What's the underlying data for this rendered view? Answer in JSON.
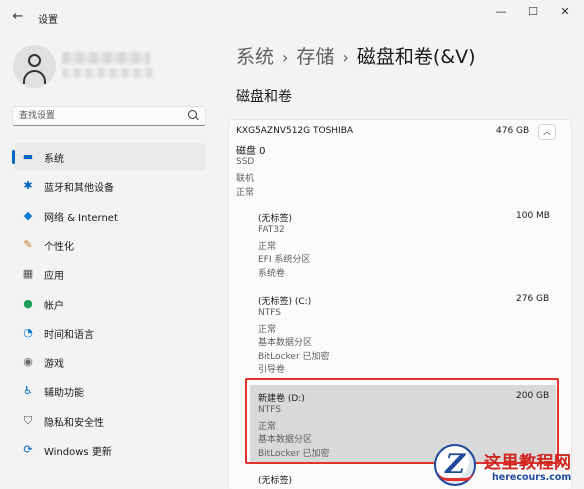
{
  "window": {
    "title": "设置",
    "back_glyph": "←",
    "minimize_glyph": "—",
    "maximize_glyph": "☐",
    "close_glyph": "✕"
  },
  "search": {
    "placeholder": "查找设置"
  },
  "sidebar": {
    "items": [
      {
        "label": "系统",
        "icon": "monitor-icon",
        "glyph": "▬",
        "color": "#0067c0",
        "active": true
      },
      {
        "label": "蓝牙和其他设备",
        "icon": "bluetooth-icon",
        "glyph": "✱",
        "color": "#0067c0",
        "active": false
      },
      {
        "label": "网络 & Internet",
        "icon": "wifi-icon",
        "glyph": "◆",
        "color": "#0078d4",
        "active": false
      },
      {
        "label": "个性化",
        "icon": "brush-icon",
        "glyph": "✎",
        "color": "#c5742a",
        "active": false
      },
      {
        "label": "应用",
        "icon": "apps-icon",
        "glyph": "▦",
        "color": "#555555",
        "active": false
      },
      {
        "label": "帐户",
        "icon": "person-icon",
        "glyph": "●",
        "color": "#1f9e57",
        "active": false
      },
      {
        "label": "时间和语言",
        "icon": "globe-clock-icon",
        "glyph": "◔",
        "color": "#0078d4",
        "active": false
      },
      {
        "label": "游戏",
        "icon": "gamepad-icon",
        "glyph": "◉",
        "color": "#666666",
        "active": false
      },
      {
        "label": "辅助功能",
        "icon": "accessibility-icon",
        "glyph": "♿",
        "color": "#0067c0",
        "active": false
      },
      {
        "label": "隐私和安全性",
        "icon": "shield-icon",
        "glyph": "⛉",
        "color": "#555555",
        "active": false
      },
      {
        "label": "Windows 更新",
        "icon": "update-icon",
        "glyph": "⟳",
        "color": "#0067c0",
        "active": false
      }
    ]
  },
  "breadcrumb": {
    "parts": [
      "系统",
      "存储"
    ],
    "current": "磁盘和卷(&V)",
    "separator": "›"
  },
  "section_title": "磁盘和卷",
  "disk": {
    "model": "KXG5AZNV512G TOSHIBA",
    "size": "476 GB",
    "collapse_glyph": "︿",
    "title": "磁盘 0",
    "details": [
      "SSD",
      "联机",
      "正常"
    ]
  },
  "partitions": [
    {
      "name": "(无标签)",
      "size": "100 MB",
      "details": [
        "FAT32",
        "正常",
        "EFI 系统分区",
        "系统卷"
      ]
    },
    {
      "name": "(无标签) (C:)",
      "size": "276 GB",
      "details": [
        "NTFS",
        "正常",
        "基本数据分区",
        "BitLocker 已加密",
        "引导卷"
      ]
    },
    {
      "name": "新建卷 (D:)",
      "size": "200 GB",
      "details": [
        "NTFS",
        "正常",
        "基本数据分区",
        "BitLocker 已加密"
      ]
    },
    {
      "name": "(无标签)",
      "size": "",
      "details": []
    }
  ],
  "watermark": {
    "logo_letter": "Z",
    "title": "这里教程网",
    "url": "herecours.com"
  }
}
